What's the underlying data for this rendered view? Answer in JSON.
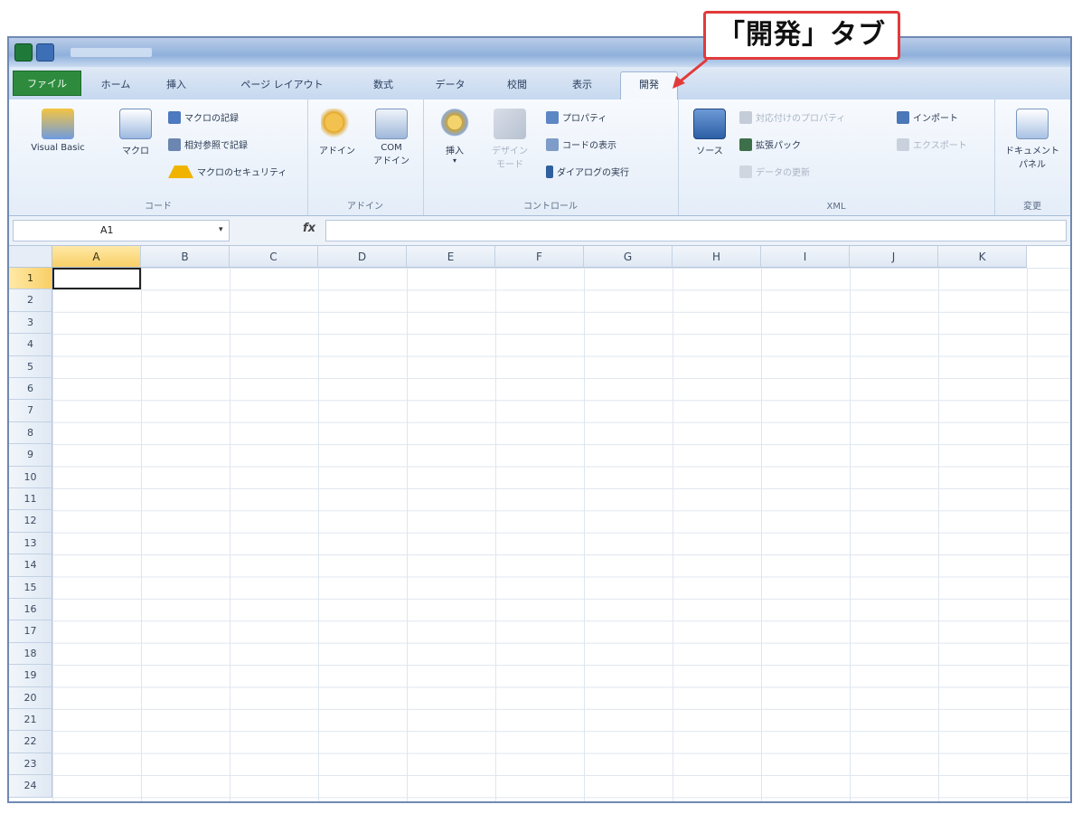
{
  "annotation": {
    "text": "「開発」タブ",
    "border_color": "#e23a3a"
  },
  "ribbon_tabs": [
    {
      "label": "ファイル",
      "state": "file"
    },
    {
      "label": "ホーム"
    },
    {
      "label": "挿入"
    },
    {
      "label": "ページ レイアウト"
    },
    {
      "label": "数式"
    },
    {
      "label": "データ"
    },
    {
      "label": "校閲"
    },
    {
      "label": "表示"
    },
    {
      "label": "開発",
      "state": "active"
    }
  ],
  "ribbon": {
    "code": {
      "group_label": "コード",
      "visual_basic": "Visual Basic",
      "macro": "マクロ",
      "record_macro": "マクロの記録",
      "relative_ref": "相対参照で記録",
      "macro_security": "マクロのセキュリティ"
    },
    "addins": {
      "group_label": "アドイン",
      "addin": "アドイン",
      "com_addin_1": "COM",
      "com_addin_2": "アドイン"
    },
    "controls": {
      "group_label": "コントロール",
      "insert": "挿入",
      "design_mode_1": "デザイン",
      "design_mode_2": "モード",
      "properties": "プロパティ",
      "view_code": "コードの表示",
      "run_dialog": "ダイアログの実行"
    },
    "xml": {
      "group_label": "XML",
      "source": "ソース",
      "map_properties": "対応付けのプロパティ",
      "expansion_packs": "拡張パック",
      "refresh_data": "データの更新",
      "import": "インポート",
      "export": "エクスポート"
    },
    "modify": {
      "group_label": "変更",
      "document_panel_1": "ドキュメント",
      "document_panel_2": "パネル"
    }
  },
  "formula_bar": {
    "name_box": "A1",
    "fx": "fx",
    "value": ""
  },
  "columns": [
    "A",
    "B",
    "C",
    "D",
    "E",
    "F",
    "G",
    "H",
    "I",
    "J",
    "K"
  ],
  "rows": [
    "1",
    "2",
    "3",
    "4",
    "5",
    "6",
    "7",
    "8",
    "9",
    "10",
    "11",
    "12",
    "13",
    "14",
    "15",
    "16",
    "17",
    "18",
    "19",
    "20",
    "21",
    "22",
    "23",
    "24"
  ],
  "selected_cell": "A1",
  "colors": {
    "file_tab": "#2e8b3e",
    "selection": "#f8cf66",
    "accent": "#e23a3a"
  }
}
